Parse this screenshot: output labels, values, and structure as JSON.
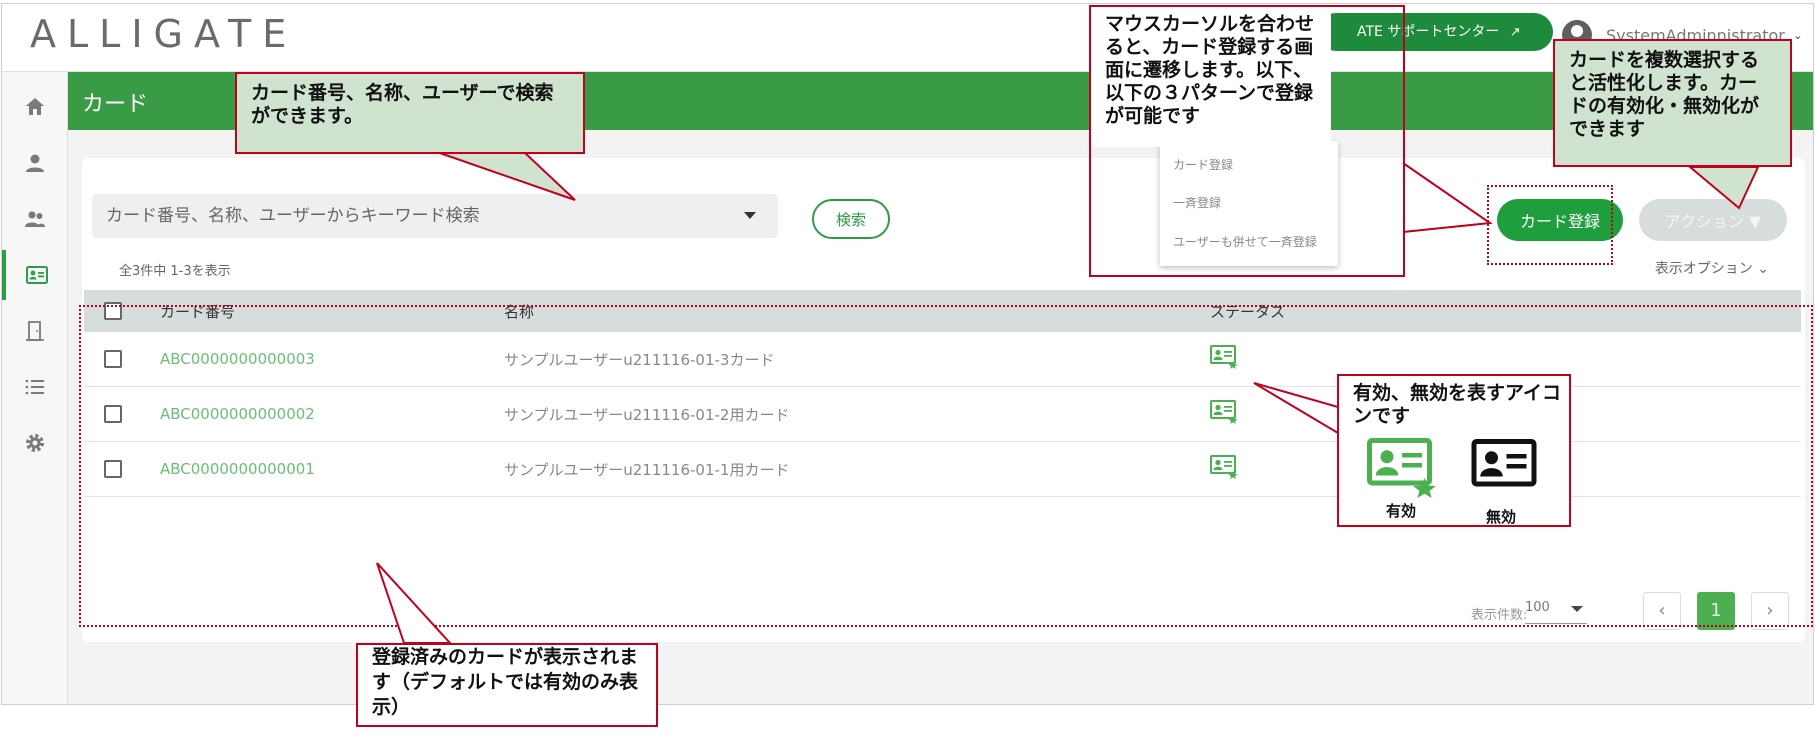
{
  "header": {
    "logo": "ALLIGATE",
    "support_link": "ATE サポートセンター",
    "user_name": "SystemAdminnistrator"
  },
  "sidebar": {
    "items": [
      {
        "icon": "home-icon"
      },
      {
        "icon": "user-icon"
      },
      {
        "icon": "users-icon"
      },
      {
        "icon": "id-card-icon",
        "active": true
      },
      {
        "icon": "door-icon"
      },
      {
        "icon": "list-icon"
      },
      {
        "icon": "gear-icon"
      }
    ]
  },
  "page": {
    "title": "カード"
  },
  "search": {
    "placeholder": "カード番号、名称、ユーザーからキーワード検索",
    "button_label": "検索"
  },
  "list_info": {
    "count_text": "全3件中 1-3を表示",
    "display_options": "表示オプション"
  },
  "toolbar": {
    "register_label": "カード登録",
    "action_label": "アクション ▼"
  },
  "register_menu": {
    "items": [
      "カード登録",
      "一斉登録",
      "ユーザーも併せて一斉登録"
    ]
  },
  "table": {
    "columns": [
      "カード番号",
      "名称",
      "ステータス"
    ],
    "rows": [
      {
        "card_number": "ABC0000000000003",
        "name": "サンプルユーザーu211116-01-3カード",
        "status_icon": "card-active-icon"
      },
      {
        "card_number": "ABC0000000000002",
        "name": "サンプルユーザーu211116-01-2用カード",
        "status_icon": "card-active-icon"
      },
      {
        "card_number": "ABC0000000000001",
        "name": "サンプルユーザーu211116-01-1用カード",
        "status_icon": "card-active-icon"
      }
    ]
  },
  "pagination": {
    "per_page_label": "表示件数:",
    "per_page_value": "100",
    "prev": "‹",
    "current_page": "1",
    "next": "›"
  },
  "annotations": {
    "search_note": "カード番号、名称、ユーザーで検索ができます。",
    "register_note": "マウスカーソルを合わせると、カード登録する画面に遷移します。以下、以下の３パターンで登録が可能です",
    "action_note": "カードを複数選択すると活性化します。カードの有効化・無効化ができます",
    "status_note": "有効、無効を表すアイコンです",
    "legend_active": "有効",
    "legend_inactive": "無効",
    "list_note": "登録済みのカードが表示されます（デフォルトでは有効のみ表示）"
  },
  "colors": {
    "brand_green": "#3a9b47",
    "button_green": "#1f9e3d",
    "annotation_red": "#c0001f",
    "annotation_fill": "#cfe3cf"
  }
}
